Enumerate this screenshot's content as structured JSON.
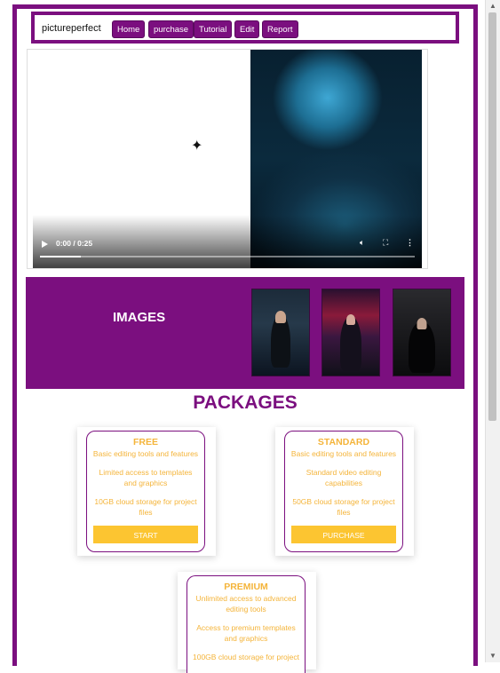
{
  "nav": {
    "brand": "pictureperfect",
    "items": [
      "Home",
      "purchase",
      "Tutorial",
      "Edit",
      "Report"
    ]
  },
  "video": {
    "time": "0:00 / 0:25",
    "progress_fraction": 0.11
  },
  "images_section": {
    "title": "IMAGES"
  },
  "packages": {
    "title": "PACKAGES",
    "cards": [
      {
        "name": "FREE",
        "features": [
          "Basic editing tools and features",
          "Limited access to templates and graphics",
          "10GB cloud storage for project files"
        ],
        "button": "START"
      },
      {
        "name": "STANDARD",
        "features": [
          "Basic editing tools and features",
          "Standard video editing capabilities",
          "50GB cloud storage for project files"
        ],
        "button": "PURCHASE"
      },
      {
        "name": "PREMIUM",
        "features": [
          "Unlimited access to advanced editing tools",
          "Access to premium templates and graphics",
          "100GB cloud storage for project"
        ]
      }
    ]
  },
  "colors": {
    "brand_purple": "#7b0f7f",
    "accent_yellow": "#fcc531",
    "text_yellow": "#f4b43a"
  }
}
